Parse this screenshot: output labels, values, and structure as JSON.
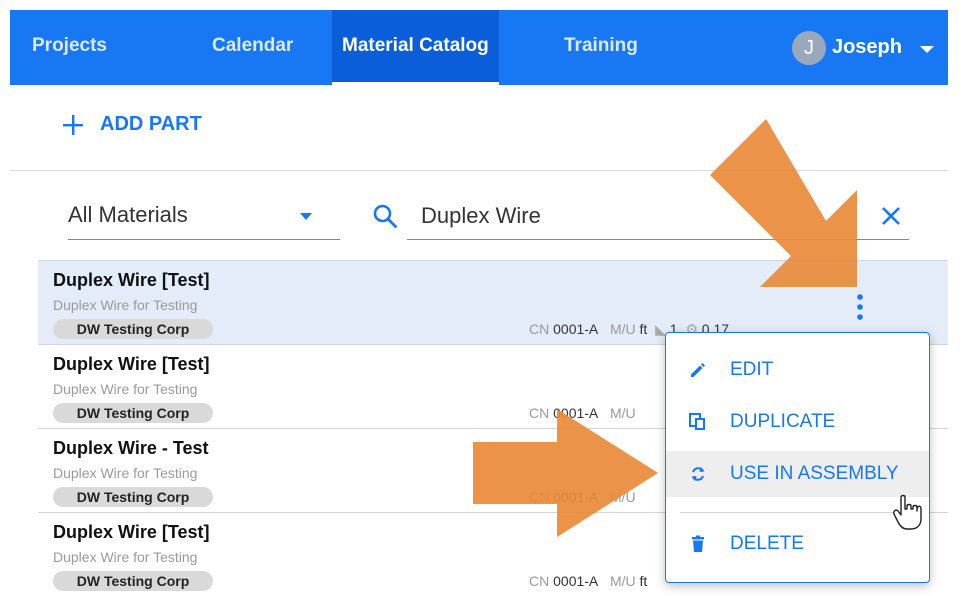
{
  "nav": {
    "items": [
      {
        "label": "Projects"
      },
      {
        "label": "Calendar"
      },
      {
        "label": "Material Catalog"
      },
      {
        "label": "Training"
      }
    ],
    "user": {
      "initial": "J",
      "name": "Joseph"
    }
  },
  "toolbar": {
    "add_part_label": "ADD PART"
  },
  "filters": {
    "category": "All Materials",
    "search_value": "Duplex Wire"
  },
  "list": [
    {
      "title": "Duplex Wire [Test]",
      "description": "Duplex Wire for Testing",
      "vendor": "DW Testing Corp",
      "cn_label": "CN",
      "cn": "0001-A",
      "mu_label": "M/U",
      "mu": "ft",
      "count": "1",
      "price": "0.17"
    },
    {
      "title": "Duplex Wire [Test]",
      "description": "Duplex Wire for Testing",
      "vendor": "DW Testing Corp",
      "cn_label": "CN",
      "cn": "0001-A",
      "mu_label": "M/U"
    },
    {
      "title": "Duplex Wire - Test",
      "description": "Duplex Wire for Testing",
      "vendor": "DW Testing Corp",
      "cn_label": "CN",
      "cn": "0001-A",
      "mu_label": "M/U"
    },
    {
      "title": "Duplex Wire [Test]",
      "description": "Duplex Wire for Testing",
      "vendor": "DW Testing Corp",
      "cn_label": "CN",
      "cn": "0001-A",
      "mu_label": "M/U",
      "mu": "ft"
    }
  ],
  "menu": {
    "edit": "EDIT",
    "duplicate": "DUPLICATE",
    "use_in_assembly": "USE IN ASSEMBLY",
    "delete": "DELETE"
  },
  "colors": {
    "brand": "#1878f3",
    "nav_active": "#0a5ed9",
    "selected_row": "#e3ecf8",
    "annotation_arrow": "#e98a3a"
  }
}
